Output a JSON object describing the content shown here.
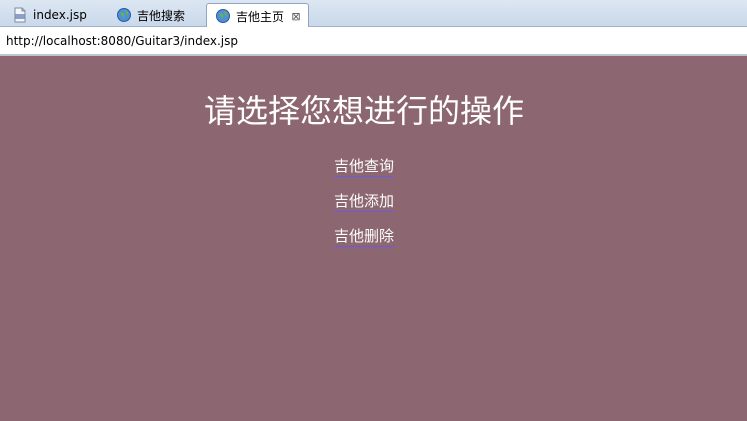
{
  "tabs": [
    {
      "label": "index.jsp",
      "icon": "jsp-file-icon",
      "active": false
    },
    {
      "label": "吉他搜索",
      "icon": "globe-icon",
      "active": false
    },
    {
      "label": "吉他主页",
      "icon": "globe-icon",
      "active": true,
      "close": "⊠"
    }
  ],
  "address": {
    "url": "http://localhost:8080/Guitar3/index.jsp"
  },
  "page": {
    "title": "请选择您想进行的操作",
    "links": [
      "吉他查询",
      "吉他添加",
      "吉他删除"
    ],
    "background_color": "#8c6670",
    "link_underline_color": "#6a5adf"
  }
}
